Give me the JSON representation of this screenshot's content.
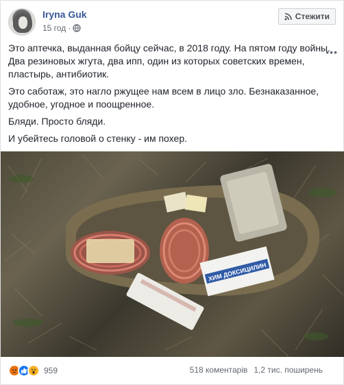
{
  "post": {
    "author": "Iryna Guk",
    "time": "15 год",
    "follow_label": "Стежити",
    "paragraphs": [
      "Это аптечка, выданная бойцу сейчас, в 2018 году. На пятом году войны. Два резиновых жгута, два ипп, один из которых советских времен, пластырь, антибиотик.",
      "Это саботаж, это нагло ржущее нам всем в лицо зло. Безнаказанное, удобное, угодное и поощренное.",
      "Бляди. Просто бляди.",
      "И убейтесь головой о стенку - им похер."
    ],
    "photo_label_box": "ХИМ ДОКСИЦИЛИН"
  },
  "footer": {
    "reaction_count": "959",
    "comments": "518 коментарів",
    "shares": "1,2 тис. поширень"
  },
  "icons": {
    "globe": "globe-icon",
    "rss": "rss-icon",
    "more": "more-options-icon",
    "reactions": [
      "angry-reaction-icon",
      "like-reaction-icon",
      "wow-reaction-icon"
    ]
  },
  "colors": {
    "author": "#385898",
    "like": "#1877f2",
    "angry": "#e9710f",
    "wow": "#f7b125"
  }
}
